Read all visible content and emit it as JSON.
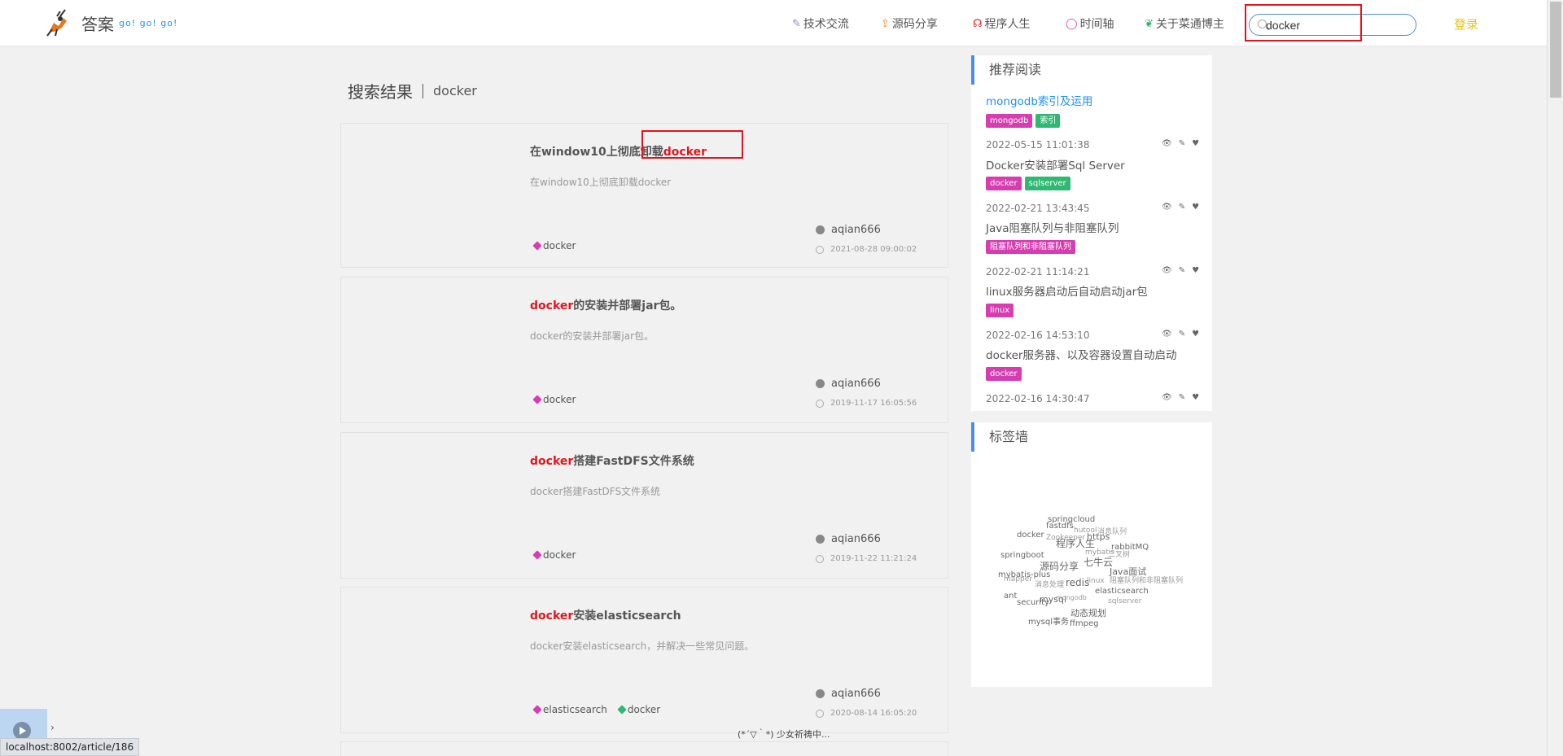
{
  "header": {
    "site_name": "答案",
    "site_sub": "go! go! go!",
    "nav": [
      {
        "label": "技术交流",
        "icon": "pen-icon",
        "color": "#8a8ad6"
      },
      {
        "label": "源码分享",
        "icon": "share-icon",
        "color": "#f08c1a"
      },
      {
        "label": "程序人生",
        "icon": "headphone-icon",
        "color": "#e8121a"
      },
      {
        "label": "时间轴",
        "icon": "circle-icon",
        "color": "#d63db0"
      },
      {
        "label": "关于菜通博主",
        "icon": "leaf-icon",
        "color": "#2eb872"
      }
    ],
    "search_value": "docker",
    "login_label": "登录"
  },
  "search": {
    "label": "搜索结果",
    "keyword": "docker"
  },
  "results": [
    {
      "title_pre": "在window10上彻底卸载",
      "title_hl": "docker",
      "title_post": "",
      "desc": "在window10上彻底卸载docker",
      "tags": [
        {
          "name": "docker",
          "color": "#d63db0"
        }
      ],
      "author": "aqian666",
      "time": "2021-08-28 09:00:02"
    },
    {
      "title_pre": "",
      "title_hl": "docker",
      "title_post": "的安装并部署jar包。",
      "desc": "docker的安装并部署jar包。",
      "tags": [
        {
          "name": "docker",
          "color": "#d63db0"
        }
      ],
      "author": "aqian666",
      "time": "2019-11-17 16:05:56"
    },
    {
      "title_pre": "",
      "title_hl": "docker",
      "title_post": "搭建FastDFS文件系统",
      "desc": "docker搭建FastDFS文件系统",
      "tags": [
        {
          "name": "docker",
          "color": "#d63db0"
        }
      ],
      "author": "aqian666",
      "time": "2019-11-22 11:21:24"
    },
    {
      "title_pre": "",
      "title_hl": "docker",
      "title_post": "安装elasticsearch",
      "desc": "docker安装elasticsearch，并解决一些常见问题。",
      "tags": [
        {
          "name": "elasticsearch",
          "color": "#d63db0"
        },
        {
          "name": "docker",
          "color": "#2eb872"
        }
      ],
      "author": "aqian666",
      "time": "2020-08-14 16:05:20"
    }
  ],
  "recommend": {
    "heading": "推荐阅读",
    "first_title": "mongodb索引及运用",
    "first_badges": [
      {
        "name": "mongodb",
        "color": "#d63db0"
      },
      {
        "name": "索引",
        "color": "#2eb872"
      }
    ],
    "items": [
      {
        "time": "2022-05-15 11:01:38",
        "title": "Docker安装部署Sql Server",
        "badges": [
          {
            "name": "docker",
            "color": "#d63db0"
          },
          {
            "name": "sqlserver",
            "color": "#2eb872"
          }
        ]
      },
      {
        "time": "2022-02-21 13:43:45",
        "title": "Java阻塞队列与非阻塞队列",
        "badges": [
          {
            "name": "阻塞队列和非阻塞队列",
            "color": "#d63db0"
          }
        ]
      },
      {
        "time": "2022-02-21 11:14:21",
        "title": "linux服务器启动后自动启动jar包",
        "badges": [
          {
            "name": "linux",
            "color": "#d63db0"
          }
        ]
      },
      {
        "time": "2022-02-16 14:53:10",
        "title": "docker服务器、以及容器设置自动启动",
        "badges": [
          {
            "name": "docker",
            "color": "#d63db0"
          }
        ]
      },
      {
        "time": "2022-02-16 14:30:47",
        "title": "",
        "badges": []
      }
    ]
  },
  "tagwall": {
    "heading": "标签墙",
    "tags": [
      {
        "text": "springcloud"
      },
      {
        "text": "fastdfs"
      },
      {
        "text": "hutool"
      },
      {
        "text": "消息队列"
      },
      {
        "text": "docker"
      },
      {
        "text": "Zookeeper"
      },
      {
        "text": "https"
      },
      {
        "text": "程序人生"
      },
      {
        "text": "rabbitMQ"
      },
      {
        "text": "mybatis"
      },
      {
        "text": "二叉树"
      },
      {
        "text": "springboot"
      },
      {
        "text": "源码分享"
      },
      {
        "text": "七牛云"
      },
      {
        "text": "Java面试"
      },
      {
        "text": "mybatis-plus"
      },
      {
        "text": "mapper"
      },
      {
        "text": "消息处理"
      },
      {
        "text": "redis"
      },
      {
        "text": "linux"
      },
      {
        "text": "阻塞队列和非阻塞队列"
      },
      {
        "text": "elasticsearch"
      },
      {
        "text": "ant"
      },
      {
        "text": "mysql"
      },
      {
        "text": "mongodb"
      },
      {
        "text": "security"
      },
      {
        "text": "动态规划"
      },
      {
        "text": "sqlserver"
      },
      {
        "text": "mysql事务"
      },
      {
        "text": "ffmpeg"
      }
    ]
  },
  "status_bar": {
    "link": "localhost:8002/article/186",
    "loading": "(*´▽｀*) 少女祈祷中..."
  }
}
